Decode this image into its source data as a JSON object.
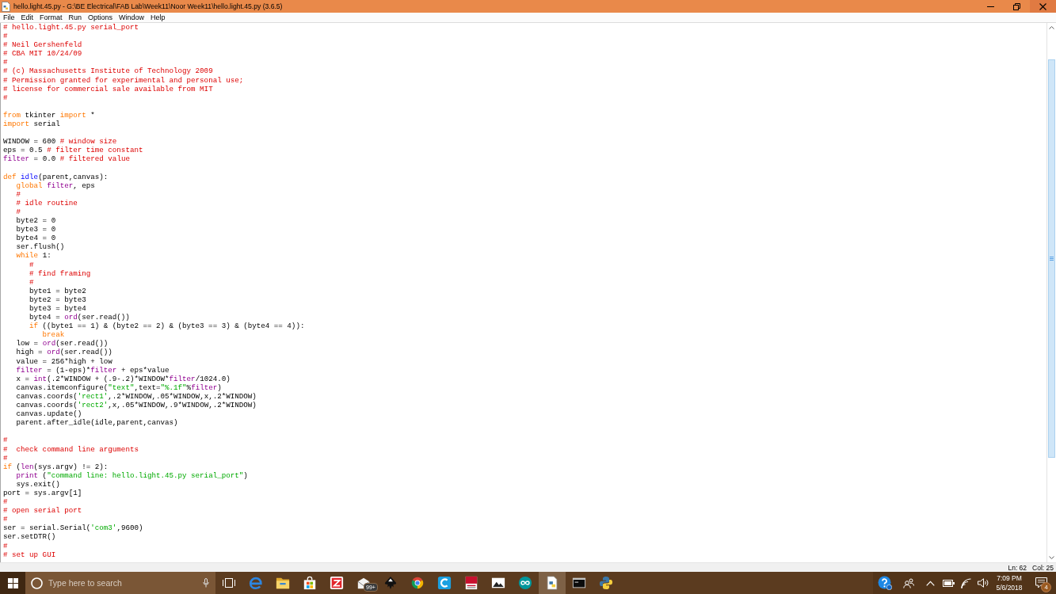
{
  "window": {
    "title": "hello.light.45.py - G:\\BE Electrical\\FAB Lab\\Week11\\Noor Week11\\hello.light.45.py (3.6.5)"
  },
  "menu": [
    "File",
    "Edit",
    "Format",
    "Run",
    "Options",
    "Window",
    "Help"
  ],
  "editor": {
    "lines": [
      {
        "kind": "code",
        "tokens": [
          {
            "kind": "comment",
            "text": "# hello.light.45.py serial_port"
          }
        ]
      },
      {
        "kind": "code",
        "tokens": [
          {
            "kind": "comment",
            "text": "#"
          }
        ]
      },
      {
        "kind": "code",
        "tokens": [
          {
            "kind": "comment",
            "text": "# Neil Gershenfeld"
          }
        ]
      },
      {
        "kind": "code",
        "tokens": [
          {
            "kind": "comment",
            "text": "# CBA MIT 10/24/09"
          }
        ]
      },
      {
        "kind": "code",
        "tokens": [
          {
            "kind": "comment",
            "text": "#"
          }
        ]
      },
      {
        "kind": "code",
        "tokens": [
          {
            "kind": "comment",
            "text": "# (c) Massachusetts Institute of Technology 2009"
          }
        ]
      },
      {
        "kind": "code",
        "tokens": [
          {
            "kind": "comment",
            "text": "# Permission granted for experimental and personal use;"
          }
        ]
      },
      {
        "kind": "code",
        "tokens": [
          {
            "kind": "comment",
            "text": "# license for commercial sale available from MIT"
          }
        ]
      },
      {
        "kind": "code",
        "tokens": [
          {
            "kind": "comment",
            "text": "#"
          }
        ]
      },
      {
        "kind": "blank"
      },
      {
        "kind": "code",
        "tokens": [
          {
            "kind": "keyword",
            "text": "from"
          },
          {
            "kind": "plain",
            "text": " tkinter "
          },
          {
            "kind": "keyword",
            "text": "import"
          },
          {
            "kind": "plain",
            "text": " *"
          }
        ]
      },
      {
        "kind": "code",
        "tokens": [
          {
            "kind": "keyword",
            "text": "import"
          },
          {
            "kind": "plain",
            "text": " serial"
          }
        ]
      },
      {
        "kind": "blank"
      },
      {
        "kind": "code",
        "tokens": [
          {
            "kind": "plain",
            "text": "WINDOW = 600 "
          },
          {
            "kind": "comment",
            "text": "# window size"
          }
        ]
      },
      {
        "kind": "code",
        "tokens": [
          {
            "kind": "plain",
            "text": "eps = 0.5 "
          },
          {
            "kind": "comment",
            "text": "# filter time constant"
          }
        ]
      },
      {
        "kind": "code",
        "tokens": [
          {
            "kind": "builtin",
            "text": "filter"
          },
          {
            "kind": "plain",
            "text": " = 0.0 "
          },
          {
            "kind": "comment",
            "text": "# filtered value"
          }
        ]
      },
      {
        "kind": "blank"
      },
      {
        "kind": "code",
        "tokens": [
          {
            "kind": "keyword",
            "text": "def "
          },
          {
            "kind": "definition",
            "text": "idle"
          },
          {
            "kind": "plain",
            "text": "(parent,canvas):"
          }
        ],
        "children": [
          {
            "kind": "code",
            "tokens": [
              {
                "kind": "keyword",
                "text": "global "
              },
              {
                "kind": "builtin",
                "text": "filter"
              },
              {
                "kind": "plain",
                "text": ", eps"
              }
            ]
          },
          {
            "kind": "code",
            "tokens": [
              {
                "kind": "comment",
                "text": "#"
              }
            ]
          },
          {
            "kind": "code",
            "tokens": [
              {
                "kind": "comment",
                "text": "# idle routine"
              }
            ]
          },
          {
            "kind": "code",
            "tokens": [
              {
                "kind": "comment",
                "text": "#"
              }
            ]
          },
          {
            "kind": "code",
            "tokens": [
              {
                "kind": "plain",
                "text": "byte2 = 0"
              }
            ]
          },
          {
            "kind": "code",
            "tokens": [
              {
                "kind": "plain",
                "text": "byte3 = 0"
              }
            ]
          },
          {
            "kind": "code",
            "tokens": [
              {
                "kind": "plain",
                "text": "byte4 = 0"
              }
            ]
          },
          {
            "kind": "code",
            "tokens": [
              {
                "kind": "plain",
                "text": "ser.flush()"
              }
            ]
          },
          {
            "kind": "code",
            "tokens": [
              {
                "kind": "keyword",
                "text": "while "
              },
              {
                "kind": "plain",
                "text": "1:"
              }
            ],
            "children": [
              {
                "kind": "code",
                "tokens": [
                  {
                    "kind": "comment",
                    "text": "#"
                  }
                ]
              },
              {
                "kind": "code",
                "tokens": [
                  {
                    "kind": "comment",
                    "text": "# find framing"
                  }
                ]
              },
              {
                "kind": "code",
                "tokens": [
                  {
                    "kind": "comment",
                    "text": "#"
                  }
                ]
              },
              {
                "kind": "code",
                "tokens": [
                  {
                    "kind": "plain",
                    "text": "byte1 = byte2"
                  }
                ]
              },
              {
                "kind": "code",
                "tokens": [
                  {
                    "kind": "plain",
                    "text": "byte2 = byte3"
                  }
                ]
              },
              {
                "kind": "code",
                "tokens": [
                  {
                    "kind": "plain",
                    "text": "byte3 = byte4"
                  }
                ]
              },
              {
                "kind": "code",
                "tokens": [
                  {
                    "kind": "plain",
                    "text": "byte4 = "
                  },
                  {
                    "kind": "builtin",
                    "text": "ord"
                  },
                  {
                    "kind": "plain",
                    "text": "(ser.read())"
                  }
                ]
              },
              {
                "kind": "code",
                "tokens": [
                  {
                    "kind": "keyword",
                    "text": "if "
                  },
                  {
                    "kind": "plain",
                    "text": "((byte1 == 1) & (byte2 == 2) & (byte3 == 3) & (byte4 == 4)):"
                  }
                ],
                "children": [
                  {
                    "kind": "code",
                    "tokens": [
                      {
                        "kind": "keyword",
                        "text": "break"
                      }
                    ]
                  }
                ]
              }
            ]
          },
          {
            "kind": "code",
            "tokens": [
              {
                "kind": "plain",
                "text": "low = "
              },
              {
                "kind": "builtin",
                "text": "ord"
              },
              {
                "kind": "plain",
                "text": "(ser.read())"
              }
            ]
          },
          {
            "kind": "code",
            "tokens": [
              {
                "kind": "plain",
                "text": "high = "
              },
              {
                "kind": "builtin",
                "text": "ord"
              },
              {
                "kind": "plain",
                "text": "(ser.read())"
              }
            ]
          },
          {
            "kind": "code",
            "tokens": [
              {
                "kind": "plain",
                "text": "value = 256*high + low"
              }
            ]
          },
          {
            "kind": "code",
            "tokens": [
              {
                "kind": "builtin",
                "text": "filter"
              },
              {
                "kind": "plain",
                "text": " = (1-eps)*"
              },
              {
                "kind": "builtin",
                "text": "filter"
              },
              {
                "kind": "plain",
                "text": " + eps*value"
              }
            ]
          },
          {
            "kind": "code",
            "tokens": [
              {
                "kind": "plain",
                "text": "x = "
              },
              {
                "kind": "builtin",
                "text": "int"
              },
              {
                "kind": "plain",
                "text": "(.2*WINDOW + (.9-.2)*WINDOW*"
              },
              {
                "kind": "builtin",
                "text": "filter"
              },
              {
                "kind": "plain",
                "text": "/1024.0)"
              }
            ]
          },
          {
            "kind": "code",
            "tokens": [
              {
                "kind": "plain",
                "text": "canvas.itemconfigure("
              },
              {
                "kind": "string",
                "text": "\"text\""
              },
              {
                "kind": "plain",
                "text": ",text="
              },
              {
                "kind": "string",
                "text": "\"%.1f\""
              },
              {
                "kind": "plain",
                "text": "%"
              },
              {
                "kind": "builtin",
                "text": "filter"
              },
              {
                "kind": "plain",
                "text": ")"
              }
            ]
          },
          {
            "kind": "code",
            "tokens": [
              {
                "kind": "plain",
                "text": "canvas.coords("
              },
              {
                "kind": "string",
                "text": "'rect1'"
              },
              {
                "kind": "plain",
                "text": ",.2*WINDOW,.05*WINDOW,x,.2*WINDOW)"
              }
            ]
          },
          {
            "kind": "code",
            "tokens": [
              {
                "kind": "plain",
                "text": "canvas.coords("
              },
              {
                "kind": "string",
                "text": "'rect2'"
              },
              {
                "kind": "plain",
                "text": ",x,.05*WINDOW,.9*WINDOW,.2*WINDOW)"
              }
            ]
          },
          {
            "kind": "code",
            "tokens": [
              {
                "kind": "plain",
                "text": "canvas.update()"
              }
            ]
          },
          {
            "kind": "code",
            "tokens": [
              {
                "kind": "plain",
                "text": "parent.after_idle(idle,parent,canvas)"
              }
            ]
          }
        ]
      },
      {
        "kind": "blank"
      },
      {
        "kind": "code",
        "tokens": [
          {
            "kind": "comment",
            "text": "#"
          }
        ]
      },
      {
        "kind": "code",
        "tokens": [
          {
            "kind": "comment",
            "text": "#  check command line arguments"
          }
        ]
      },
      {
        "kind": "code",
        "tokens": [
          {
            "kind": "comment",
            "text": "#"
          }
        ]
      },
      {
        "kind": "code",
        "tokens": [
          {
            "kind": "keyword",
            "text": "if "
          },
          {
            "kind": "plain",
            "text": "("
          },
          {
            "kind": "builtin",
            "text": "len"
          },
          {
            "kind": "plain",
            "text": "(sys.argv) != 2):"
          }
        ],
        "children": [
          {
            "kind": "code",
            "tokens": [
              {
                "kind": "builtin",
                "text": "print"
              },
              {
                "kind": "plain",
                "text": " ("
              },
              {
                "kind": "string",
                "text": "\"command line: hello.light.45.py serial_port\""
              },
              {
                "kind": "plain",
                "text": ")"
              }
            ]
          },
          {
            "kind": "code",
            "tokens": [
              {
                "kind": "plain",
                "text": "sys.exit()"
              }
            ]
          }
        ]
      },
      {
        "kind": "code",
        "tokens": [
          {
            "kind": "plain",
            "text": "port = sys.argv[1]"
          }
        ]
      },
      {
        "kind": "code",
        "tokens": [
          {
            "kind": "comment",
            "text": "#"
          }
        ]
      },
      {
        "kind": "code",
        "tokens": [
          {
            "kind": "comment",
            "text": "# open serial port"
          }
        ]
      },
      {
        "kind": "code",
        "tokens": [
          {
            "kind": "comment",
            "text": "#"
          }
        ]
      },
      {
        "kind": "code",
        "tokens": [
          {
            "kind": "plain",
            "text": "ser = serial.Serial("
          },
          {
            "kind": "string",
            "text": "'com3'"
          },
          {
            "kind": "plain",
            "text": ",9600)"
          }
        ]
      },
      {
        "kind": "code",
        "tokens": [
          {
            "kind": "plain",
            "text": "ser.setDTR()"
          }
        ]
      },
      {
        "kind": "code",
        "tokens": [
          {
            "kind": "comment",
            "text": "#"
          }
        ]
      },
      {
        "kind": "code",
        "tokens": [
          {
            "kind": "comment",
            "text": "# set up GUI"
          }
        ]
      }
    ]
  },
  "status_bar": {
    "line": "Ln: 62",
    "column": "Col: 25"
  },
  "taskbar": {
    "search": {
      "placeholder": "Type here to search"
    },
    "apps": [
      {
        "kind": "browser",
        "selected": false
      },
      {
        "kind": "folder",
        "selected": false
      },
      {
        "kind": "bag",
        "selected": false
      },
      {
        "kind": "zigzag",
        "selected": false
      },
      {
        "kind": "mail",
        "selected": false,
        "badge": "99+"
      },
      {
        "kind": "nib",
        "selected": false
      },
      {
        "kind": "sphere",
        "selected": false
      },
      {
        "kind": "crescent",
        "selected": false
      },
      {
        "kind": "slides",
        "selected": false
      },
      {
        "kind": "photo",
        "selected": false
      },
      {
        "kind": "infinity",
        "selected": false
      },
      {
        "kind": "script",
        "selected": true
      },
      {
        "kind": "terminal",
        "selected": false
      },
      {
        "kind": "snake",
        "selected": false
      }
    ],
    "clock": {
      "time": "7:09 PM",
      "date": "5/6/2018"
    },
    "notifications": {
      "badge": "4"
    }
  }
}
